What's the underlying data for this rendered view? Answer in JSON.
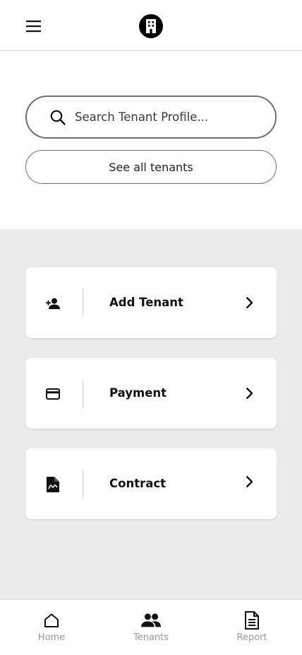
{
  "header": {
    "menu_icon": "hamburger-menu-icon",
    "logo_icon": "building-icon"
  },
  "search": {
    "placeholder": "Search Tenant Profile...",
    "value": "",
    "icon": "search-icon"
  },
  "see_all_label": "See all tenants",
  "actions": [
    {
      "label": "Add Tenant",
      "icon": "person-add-icon"
    },
    {
      "label": "Payment",
      "icon": "credit-card-icon"
    },
    {
      "label": "Contract",
      "icon": "contract-document-icon"
    }
  ],
  "bottom_nav": [
    {
      "label": "Home",
      "icon": "home-icon",
      "active": false
    },
    {
      "label": "Tenants",
      "icon": "people-icon",
      "active": true
    },
    {
      "label": "Report",
      "icon": "report-document-icon",
      "active": false
    }
  ],
  "colors": {
    "background_gray": "#ebebeb",
    "text_dark": "#111111",
    "nav_inactive": "#9a9a9a"
  }
}
